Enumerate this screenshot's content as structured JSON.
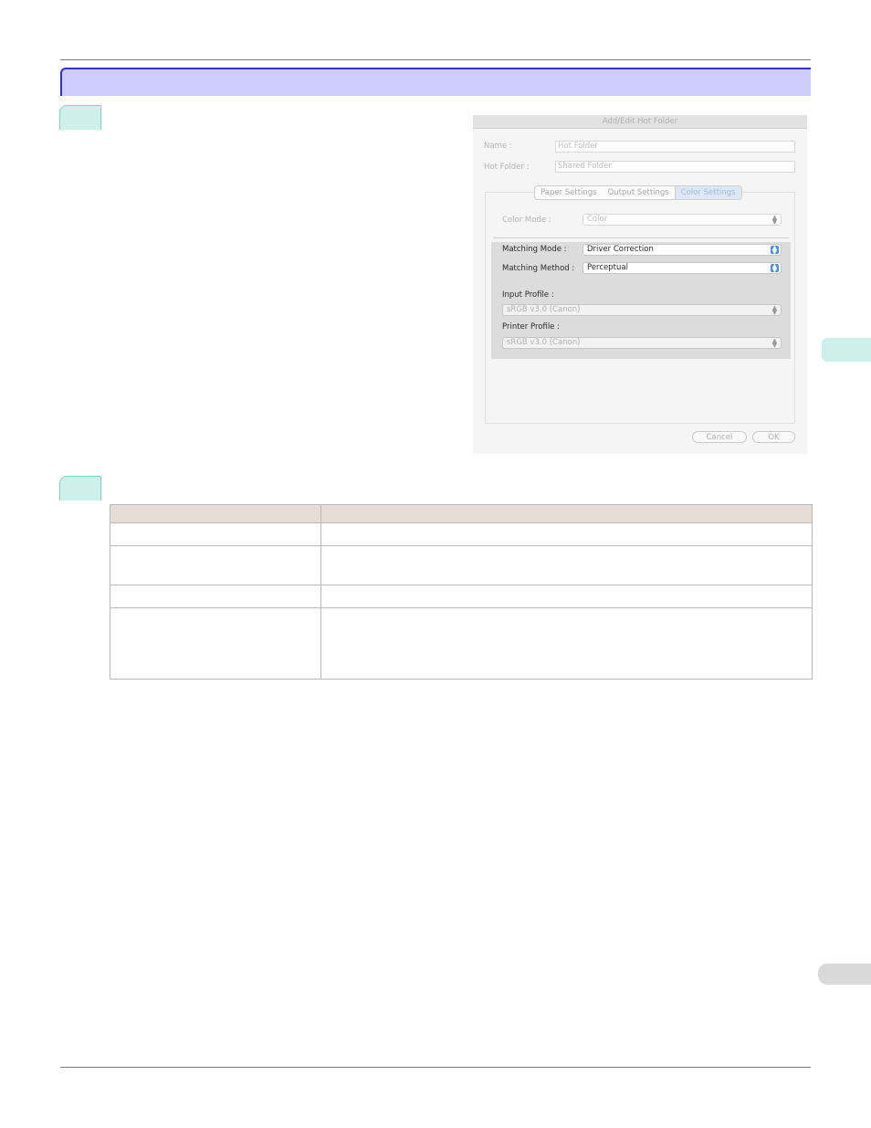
{
  "dialog": {
    "title": "Add/Edit Hot Folder",
    "name_label": "Name :",
    "name_value": "Hot Folder",
    "hot_folder_label": "Hot Folder :",
    "hot_folder_value": "Shared Folder",
    "tabs": [
      {
        "label": "Paper Settings",
        "selected": false
      },
      {
        "label": "Output Settings",
        "selected": false
      },
      {
        "label": "Color Settings",
        "selected": true
      }
    ],
    "color_mode_label": "Color Mode :",
    "color_mode_value": "Color",
    "matching_mode_label": "Matching Mode :",
    "matching_mode_value": "Driver Correction",
    "matching_method_label": "Matching Method :",
    "matching_method_value": "Perceptual",
    "input_profile_label": "Input Profile :",
    "input_profile_value": "sRGB v3.0 (Canon)",
    "printer_profile_label": "Printer Profile :",
    "printer_profile_value": "sRGB v3.0 (Canon)",
    "cancel_label": "Cancel",
    "ok_label": "OK"
  },
  "colors": {
    "section_bar": "#ccccff",
    "section_border": "#3333cc",
    "step_tab": "#cdf0ea",
    "table_header": "#e6ddd6"
  }
}
